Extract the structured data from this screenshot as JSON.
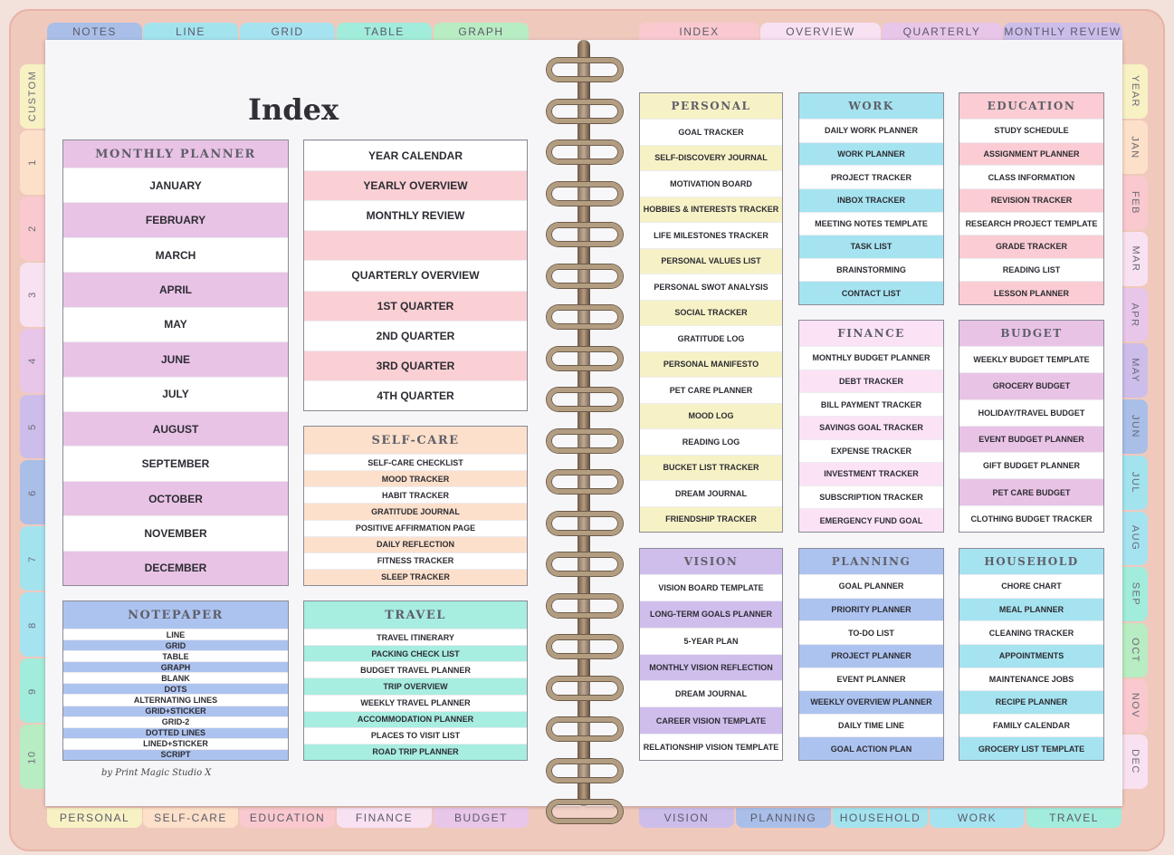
{
  "top_tabs_left": [
    {
      "label": "NOTES",
      "color": "#a9bfe8"
    },
    {
      "label": "LINE",
      "color": "#a3e3ee"
    },
    {
      "label": "GRID",
      "color": "#a6e3f0"
    },
    {
      "label": "TABLE",
      "color": "#a2ecdb"
    },
    {
      "label": "GRAPH",
      "color": "#b8ecc2"
    }
  ],
  "top_tabs_right": [
    {
      "label": "INDEX",
      "color": "#f9c9cf"
    },
    {
      "label": "OVERVIEW",
      "color": "#f8e1f1"
    },
    {
      "label": "QUARTERLY",
      "color": "#e8c6ea"
    },
    {
      "label": "MONTHLY REVIEW",
      "color": "#cdbdea"
    }
  ],
  "bottom_tabs_left": [
    {
      "label": "PERSONAL",
      "color": "#f7f1c4"
    },
    {
      "label": "SELF-CARE",
      "color": "#fde0c9"
    },
    {
      "label": "EDUCATION",
      "color": "#f9c9cf"
    },
    {
      "label": "FINANCE",
      "color": "#f8e1f1"
    },
    {
      "label": "BUDGET",
      "color": "#e8c6ea"
    }
  ],
  "bottom_tabs_right": [
    {
      "label": "VISION",
      "color": "#cdbdea"
    },
    {
      "label": "PLANNING",
      "color": "#a9bfe8"
    },
    {
      "label": "HOUSEHOLD",
      "color": "#a3e3ee"
    },
    {
      "label": "WORK",
      "color": "#a6e3f0"
    },
    {
      "label": "TRAVEL",
      "color": "#a2ecdb"
    }
  ],
  "left_side_tabs": [
    {
      "label": "CUSTOM",
      "color": "#f7f1c4"
    },
    {
      "label": "1",
      "color": "#fde0c9"
    },
    {
      "label": "2",
      "color": "#f9c9cf"
    },
    {
      "label": "3",
      "color": "#f8e1f1"
    },
    {
      "label": "4",
      "color": "#e8c6ea"
    },
    {
      "label": "5",
      "color": "#cdbdea"
    },
    {
      "label": "6",
      "color": "#a9bfe8"
    },
    {
      "label": "7",
      "color": "#a3e3ee"
    },
    {
      "label": "8",
      "color": "#a6e3f0"
    },
    {
      "label": "9",
      "color": "#a2ecdb"
    },
    {
      "label": "10",
      "color": "#b8ecc2"
    }
  ],
  "right_side_tabs": [
    {
      "label": "YEAR",
      "color": "#f7f1c4"
    },
    {
      "label": "JAN",
      "color": "#fde0c9"
    },
    {
      "label": "FEB",
      "color": "#f9c9cf"
    },
    {
      "label": "MAR",
      "color": "#f8e1f1"
    },
    {
      "label": "APR",
      "color": "#e8c6ea"
    },
    {
      "label": "MAY",
      "color": "#cdbdea"
    },
    {
      "label": "JUN",
      "color": "#a9bfe8"
    },
    {
      "label": "JUL",
      "color": "#a3e3ee"
    },
    {
      "label": "AUG",
      "color": "#a6e3f0"
    },
    {
      "label": "SEP",
      "color": "#a2ecdb"
    },
    {
      "label": "OCT",
      "color": "#b8ecc2"
    },
    {
      "label": "NOV",
      "color": "#f9c9cf"
    },
    {
      "label": "DEC",
      "color": "#f8e1f1"
    }
  ],
  "page_title": "Index",
  "signature": "by Print Magic Studio X",
  "sections": {
    "monthly_planner": {
      "title": "MONTHLY PLANNER",
      "color": "#e9c3e6",
      "header_bg": "#e9c3e6",
      "items": [
        "JANUARY",
        "FEBRUARY",
        "MARCH",
        "APRIL",
        "MAY",
        "JUNE",
        "JULY",
        "AUGUST",
        "SEPTEMBER",
        "OCTOBER",
        "NOVEMBER",
        "DECEMBER"
      ]
    },
    "overview": {
      "title": "",
      "color": "#fbd0d5",
      "header_bg": "",
      "items": [
        "YEAR CALENDAR",
        "YEARLY OVERVIEW",
        "MONTHLY REVIEW",
        "",
        "QUARTERLY OVERVIEW",
        "1ST QUARTER",
        "2ND QUARTER",
        "3RD QUARTER",
        "4TH QUARTER"
      ]
    },
    "notepaper": {
      "title": "NOTEPAPER",
      "color": "#adc3ef",
      "header_bg": "#adc3ef",
      "items": [
        "LINE",
        "GRID",
        "TABLE",
        "GRAPH",
        "BLANK",
        "DOTS",
        "ALTERNATING LINES",
        "GRID+STICKER",
        "GRID-2",
        "DOTTED LINES",
        "LINED+STICKER",
        "SCRIPT"
      ]
    },
    "self_care": {
      "title": "SELF-CARE",
      "color": "#fde0cb",
      "header_bg": "#fde0cb",
      "items": [
        "SELF-CARE CHECKLIST",
        "MOOD TRACKER",
        "HABIT TRACKER",
        "GRATITUDE JOURNAL",
        "POSITIVE AFFIRMATION PAGE",
        "DAILY REFLECTION",
        "FITNESS TRACKER",
        "SLEEP TRACKER"
      ]
    },
    "travel": {
      "title": "TRAVEL",
      "color": "#a7ede0",
      "header_bg": "#a7ede0",
      "items": [
        "TRAVEL ITINERARY",
        "PACKING CHECK LIST",
        "BUDGET TRAVEL PLANNER",
        "TRIP OVERVIEW",
        "WEEKLY TRAVEL PLANNER",
        "ACCOMMODATION PLANNER",
        "PLACES TO VISIT LIST",
        "ROAD TRIP PLANNER"
      ]
    },
    "personal": {
      "title": "PERSONAL",
      "color": "#f7f2c6",
      "header_bg": "#f7f2c6",
      "items": [
        "GOAL TRACKER",
        "SELF-DISCOVERY JOURNAL",
        "MOTIVATION BOARD",
        "HOBBIES & INTERESTS TRACKER",
        "LIFE MILESTONES TRACKER",
        "PERSONAL VALUES LIST",
        "PERSONAL SWOT ANALYSIS",
        "SOCIAL TRACKER",
        "GRATITUDE LOG",
        "PERSONAL MANIFESTO",
        "PET CARE PLANNER",
        "MOOD LOG",
        "READING LOG",
        "BUCKET LIST TRACKER",
        "DREAM JOURNAL",
        "FRIENDSHIP TRACKER"
      ]
    },
    "work": {
      "title": "WORK",
      "color": "#a6e3f0",
      "header_bg": "#a6e3f0",
      "items": [
        "DAILY WORK PLANNER",
        "WORK PLANNER",
        "PROJECT TRACKER",
        "INBOX TRACKER",
        "MEETING NOTES TEMPLATE",
        "TASK LIST",
        "BRAINSTORMING",
        "CONTACT LIST"
      ]
    },
    "education": {
      "title": "EDUCATION",
      "color": "#fbccd3",
      "header_bg": "#fbccd3",
      "items": [
        "STUDY SCHEDULE",
        "ASSIGNMENT PLANNER",
        "CLASS INFORMATION",
        "REVISION TRACKER",
        "RESEARCH PROJECT TEMPLATE",
        "GRADE TRACKER",
        "READING LIST",
        "LESSON PLANNER"
      ]
    },
    "finance": {
      "title": "FINANCE",
      "color": "#fbe3f5",
      "header_bg": "#fbe3f5",
      "items": [
        "MONTHLY BUDGET PLANNER",
        "DEBT TRACKER",
        "BILL PAYMENT TRACKER",
        "SAVINGS GOAL TRACKER",
        "EXPENSE TRACKER",
        "INVESTMENT TRACKER",
        "SUBSCRIPTION TRACKER",
        "EMERGENCY FUND GOAL"
      ]
    },
    "budget": {
      "title": "BUDGET",
      "color": "#e9c3e6",
      "header_bg": "#e9c3e6",
      "items": [
        "WEEKLY BUDGET TEMPLATE",
        "GROCERY BUDGET",
        "HOLIDAY/TRAVEL BUDGET",
        "EVENT BUDGET PLANNER",
        "GIFT BUDGET PLANNER",
        "PET CARE BUDGET",
        "CLOTHING BUDGET TRACKER"
      ]
    },
    "vision": {
      "title": "VISION",
      "color": "#cfbeec",
      "header_bg": "#cfbeec",
      "items": [
        "VISION BOARD TEMPLATE",
        "LONG-TERM GOALS PLANNER",
        "5-YEAR PLAN",
        "MONTHLY VISION REFLECTION",
        "DREAM JOURNAL",
        "CAREER VISION TEMPLATE",
        "RELATIONSHIP VISION TEMPLATE"
      ]
    },
    "planning": {
      "title": "PLANNING",
      "color": "#adc3ef",
      "header_bg": "#adc3ef",
      "items": [
        "GOAL PLANNER",
        "PRIORITY PLANNER",
        "TO-DO LIST",
        "PROJECT PLANNER",
        "EVENT PLANNER",
        "WEEKLY OVERVIEW PLANNER",
        "DAILY TIME LINE",
        "GOAL ACTION PLAN"
      ]
    },
    "household": {
      "title": "HOUSEHOLD",
      "color": "#a6e3f0",
      "header_bg": "#a6e3f0",
      "items": [
        "CHORE CHART",
        "MEAL PLANNER",
        "CLEANING TRACKER",
        "APPOINTMENTS",
        "MAINTENANCE JOBS",
        "RECIPE PLANNER",
        "FAMILY CALENDAR",
        "GROCERY LIST TEMPLATE"
      ]
    }
  }
}
